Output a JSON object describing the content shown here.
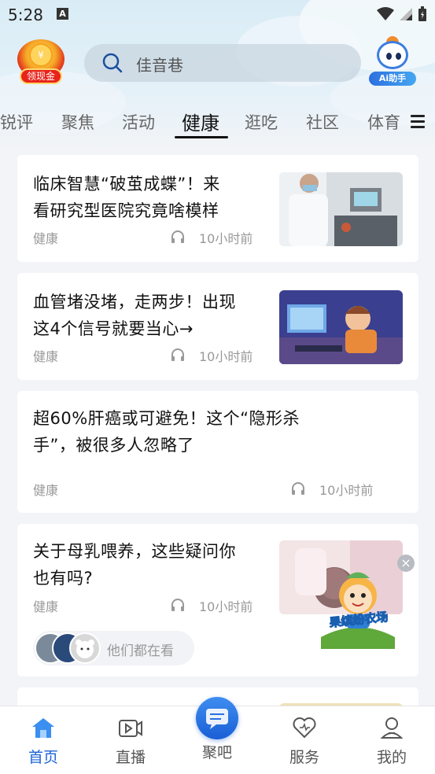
{
  "status_bar": {
    "time": "5:28",
    "app_icon_letter": "A"
  },
  "header": {
    "redpack_coin": "¥",
    "redpack_label": "领现金",
    "search_placeholder": "佳音巷",
    "ai_label": "Ai助手"
  },
  "tabs": [
    {
      "label": "锐评",
      "active": false
    },
    {
      "label": "聚焦",
      "active": false
    },
    {
      "label": "活动",
      "active": false
    },
    {
      "label": "健康",
      "active": true
    },
    {
      "label": "逛吃",
      "active": false
    },
    {
      "label": "社区",
      "active": false
    },
    {
      "label": "体育",
      "active": false
    }
  ],
  "articles": [
    {
      "title_line1": "临床智慧“破茧成蝶”！来",
      "title_line2": "看研究型医院究竟啥模样",
      "category": "健康",
      "time": "10小时前",
      "has_thumb": true
    },
    {
      "title_line1": "血管堵没堵，走两步！出现",
      "title_line2": "这4个信号就要当心→",
      "category": "健康",
      "time": "10小时前",
      "has_thumb": true
    },
    {
      "title_line1": "超60%肝癌或可避免！这个“隐形杀",
      "title_line2": "手”，被很多人忽略了",
      "category": "健康",
      "time": "10小时前",
      "has_thumb": false
    },
    {
      "title_line1": "关于母乳喂养，这些疑问你",
      "title_line2": "也有吗?",
      "category": "健康",
      "time": "10小时前",
      "has_thumb": true,
      "watching_text": "他们都在看"
    }
  ],
  "promo": {
    "text": "果缤纷农场",
    "close": "×"
  },
  "bottom_nav": [
    {
      "label": "首页",
      "icon": "home-icon",
      "active": true
    },
    {
      "label": "直播",
      "icon": "video-icon",
      "active": false
    },
    {
      "label": "聚吧",
      "icon": "chat-icon",
      "active": false
    },
    {
      "label": "服务",
      "icon": "heart-icon",
      "active": false
    },
    {
      "label": "我的",
      "icon": "user-icon",
      "active": false
    }
  ],
  "colors": {
    "accent": "#1a63d6",
    "muted": "#999999",
    "redpack": "#e8231a"
  }
}
